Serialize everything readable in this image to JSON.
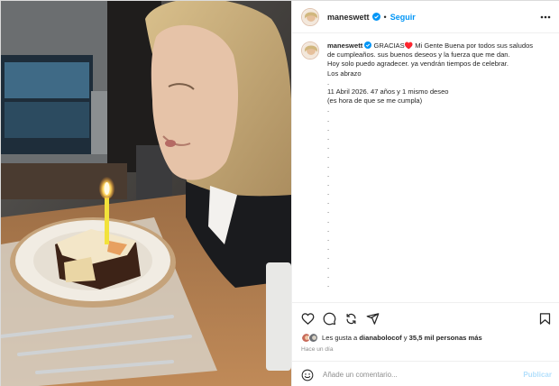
{
  "post": {
    "username": "maneswett",
    "follow_label": "Seguir",
    "separator": "•"
  },
  "caption": {
    "username": "maneswett",
    "lines": [
      "GRACIAS♥️ Mi Gente Buena por todos sus saludos",
      "de cumpleaños. sus buenos deseos y la fuerza que me dan.",
      "Hoy solo puedo agradecer. ya vendrán tiempos de celebrar.",
      "Los abrazo",
      ".",
      "11 Abril 2026. 47 años y 1 mismo deseo",
      "(es hora de que se me cumpla)"
    ],
    "dots": [
      ".",
      ".",
      ".",
      ".",
      ".",
      ".",
      ".",
      ".",
      ".",
      ".",
      ".",
      ".",
      ".",
      ".",
      ".",
      ".",
      ".",
      ".",
      ".",
      "."
    ]
  },
  "likes": {
    "prefix": "Les gusta a ",
    "user": "dianabolocof",
    "middle": " y ",
    "count": "35,5 mil personas más"
  },
  "timestamp": "Hace un día",
  "comment": {
    "placeholder": "Añade un comentario...",
    "publish_label": "Publicar"
  },
  "icons": {
    "verified": "verified-badge-icon",
    "more": "more-options-icon",
    "like": "heart-icon",
    "comment": "comment-icon",
    "share": "repost-icon",
    "send": "send-icon",
    "save": "bookmark-icon",
    "emoji": "emoji-icon"
  },
  "colors": {
    "accent": "#0095f6",
    "publish_disabled": "#b2dffc",
    "muted": "#8e8e8e"
  }
}
